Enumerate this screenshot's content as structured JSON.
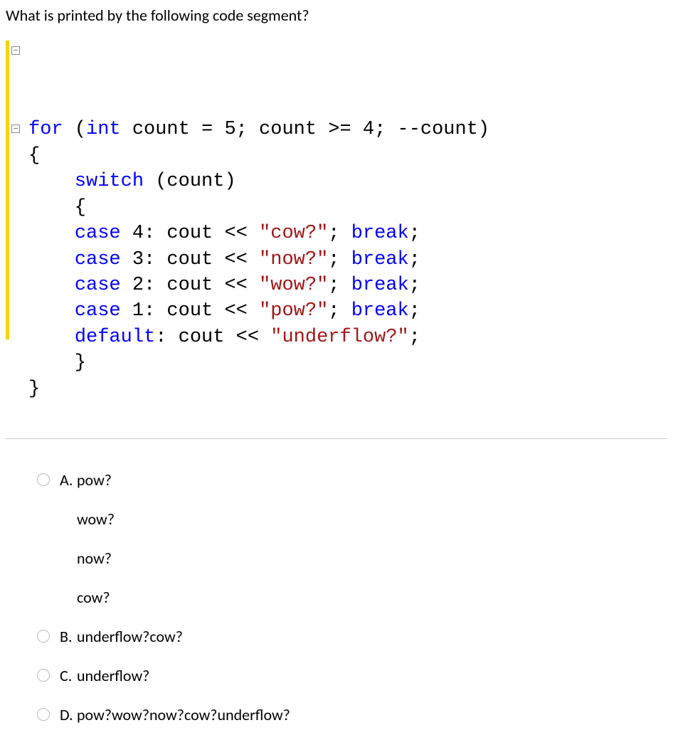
{
  "question": "What is printed by the following code segment?",
  "code": {
    "lines": [
      {
        "seg": [
          {
            "t": "for",
            "c": "kw"
          },
          {
            "t": " ("
          },
          {
            "t": "int",
            "c": "kw"
          },
          {
            "t": " count = 5; count >= 4; --count)"
          }
        ]
      },
      {
        "seg": [
          {
            "t": "{"
          }
        ]
      },
      {
        "seg": [
          {
            "t": "    "
          },
          {
            "t": "switch",
            "c": "kw"
          },
          {
            "t": " (count)"
          }
        ]
      },
      {
        "seg": [
          {
            "t": "    {"
          }
        ]
      },
      {
        "seg": [
          {
            "t": "    "
          },
          {
            "t": "case",
            "c": "kw"
          },
          {
            "t": " 4: cout << "
          },
          {
            "t": "\"cow?\"",
            "c": "str"
          },
          {
            "t": "; "
          },
          {
            "t": "break",
            "c": "kw"
          },
          {
            "t": ";"
          }
        ]
      },
      {
        "seg": [
          {
            "t": "    "
          },
          {
            "t": "case",
            "c": "kw"
          },
          {
            "t": " 3: cout << "
          },
          {
            "t": "\"now?\"",
            "c": "str"
          },
          {
            "t": "; "
          },
          {
            "t": "break",
            "c": "kw"
          },
          {
            "t": ";"
          }
        ]
      },
      {
        "seg": [
          {
            "t": "    "
          },
          {
            "t": "case",
            "c": "kw"
          },
          {
            "t": " 2: cout << "
          },
          {
            "t": "\"wow?\"",
            "c": "str"
          },
          {
            "t": "; "
          },
          {
            "t": "break",
            "c": "kw"
          },
          {
            "t": ";"
          }
        ]
      },
      {
        "seg": [
          {
            "t": "    "
          },
          {
            "t": "case",
            "c": "kw"
          },
          {
            "t": " 1: cout << "
          },
          {
            "t": "\"pow?\"",
            "c": "str"
          },
          {
            "t": "; "
          },
          {
            "t": "break",
            "c": "kw"
          },
          {
            "t": ";"
          }
        ]
      },
      {
        "seg": [
          {
            "t": "    "
          },
          {
            "t": "default",
            "c": "kw"
          },
          {
            "t": ": cout << "
          },
          {
            "t": "\"underflow?\"",
            "c": "str"
          },
          {
            "t": ";"
          }
        ]
      },
      {
        "seg": [
          {
            "t": "    }"
          }
        ]
      },
      {
        "seg": [
          {
            "t": "}"
          }
        ]
      }
    ]
  },
  "options": [
    {
      "label": "A.",
      "lines": [
        "pow?",
        "wow?",
        "now?",
        "cow?"
      ]
    },
    {
      "label": "B.",
      "lines": [
        "underflow?cow?"
      ]
    },
    {
      "label": "C.",
      "lines": [
        "underflow?"
      ]
    },
    {
      "label": "D.",
      "lines": [
        "pow?wow?now?cow?underflow?"
      ]
    }
  ]
}
